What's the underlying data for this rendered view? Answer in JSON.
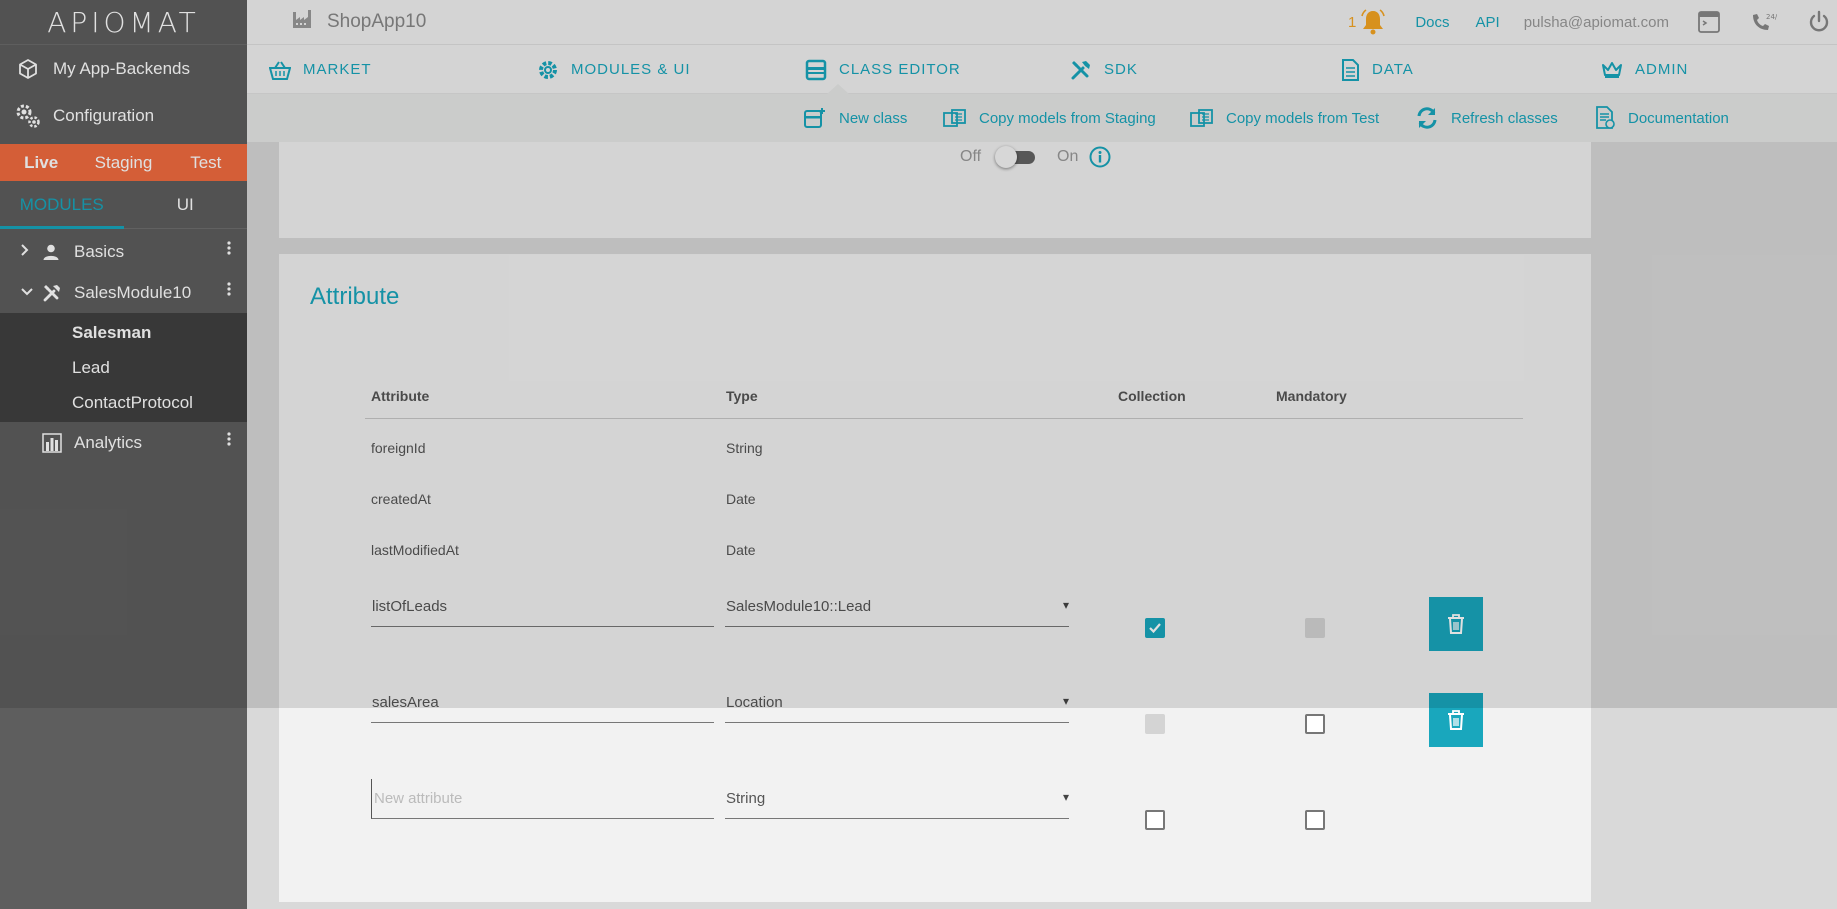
{
  "logo": "APIOMAT",
  "sidebar": {
    "links": [
      {
        "label": "My App-Backends"
      },
      {
        "label": "Configuration"
      }
    ],
    "env_tabs": [
      {
        "label": "Live"
      },
      {
        "label": "Staging"
      },
      {
        "label": "Test"
      }
    ],
    "module_tabs": [
      {
        "label": "MODULES"
      },
      {
        "label": "UI"
      }
    ],
    "tree": {
      "basics": "Basics",
      "sales_module": "SalesModule10",
      "sub_items": [
        "Salesman",
        "Lead",
        "ContactProtocol"
      ],
      "analytics": "Analytics"
    }
  },
  "topbar": {
    "app_name": "ShopApp10",
    "notification_count": "1",
    "docs": "Docs",
    "api": "API",
    "email": "pulsha@apiomat.com"
  },
  "mainnav": {
    "items": [
      "MARKET",
      "MODULES & UI",
      "CLASS EDITOR",
      "SDK",
      "DATA",
      "ADMIN"
    ]
  },
  "subnav": {
    "actions": [
      "New class",
      "Copy models from Staging",
      "Copy models from Test",
      "Refresh classes",
      "Documentation"
    ]
  },
  "toggle": {
    "off_label": "Off",
    "on_label": "On"
  },
  "attributes": {
    "title": "Attribute",
    "headers": [
      "Attribute",
      "Type",
      "Collection",
      "Mandatory"
    ],
    "readonly_rows": [
      {
        "name": "foreignId",
        "type": "String"
      },
      {
        "name": "createdAt",
        "type": "Date"
      },
      {
        "name": "lastModifiedAt",
        "type": "Date"
      }
    ],
    "editable_rows": [
      {
        "name": "listOfLeads",
        "type": "SalesModule10::Lead",
        "collection": "checked",
        "mandatory": "disabled"
      },
      {
        "name": "salesArea",
        "type": "Location",
        "collection": "disabled",
        "mandatory": "unchecked"
      }
    ],
    "new_row": {
      "placeholder": "New attribute",
      "type": "String"
    }
  },
  "colors": {
    "accent": "#19a7bd",
    "env_bar": "#f26c3f",
    "notification": "#f5a623"
  }
}
